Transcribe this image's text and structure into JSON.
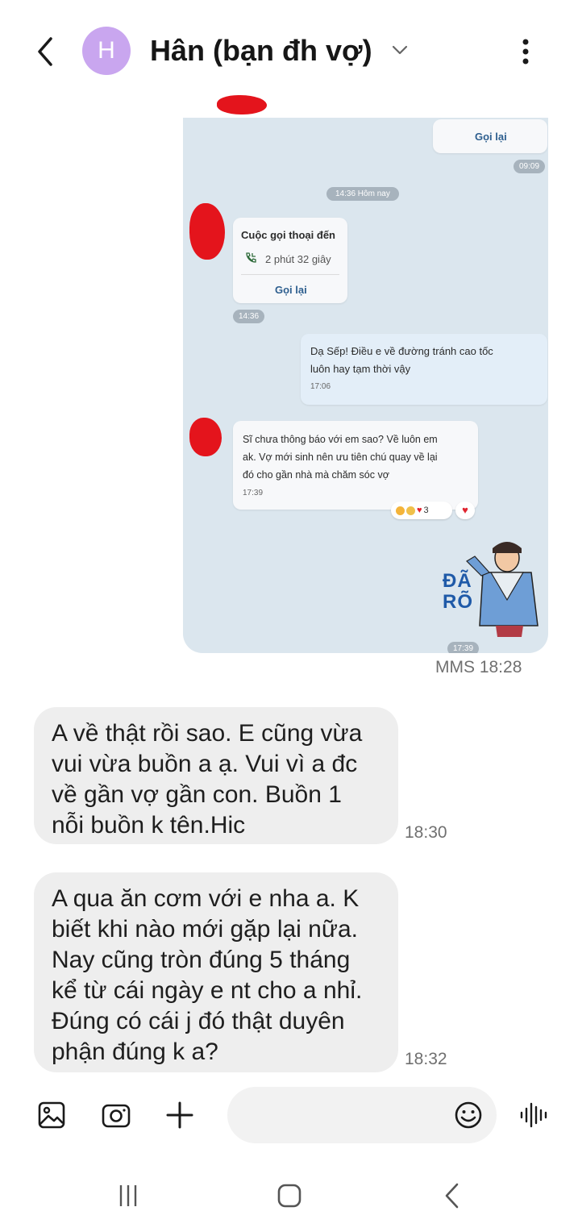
{
  "header": {
    "avatar_letter": "H",
    "contact_name": "Hân (bạn đh vợ)",
    "avatar_color": "#c9a6ef"
  },
  "screenshot": {
    "call_back_label_top": "Gọi lại",
    "time_top": "09:09",
    "date_divider": "14:36 Hôm nay",
    "incoming_call_title": "Cuộc gọi thoại đến",
    "call_duration": "2 phút 32 giây",
    "call_back_label": "Gọi lại",
    "call_time": "14:36",
    "sent_text_line1": "Dạ Sếp! Điều e về đường tránh cao tốc",
    "sent_text_line2": "luôn hay tạm thời vậy",
    "sent_time": "17:06",
    "reply_line1": "Sĩ chưa thông báo với em sao? Về luôn em",
    "reply_line2": "ak. Vợ mới sinh nên ưu tiên chú quay về lại",
    "reply_line3": "đó cho gần nhà mà chăm sóc vợ",
    "reply_time": "17:39",
    "reaction_count": "3",
    "sticker_text": "ĐÃ RÕ",
    "sticker_time": "17:39"
  },
  "mms_meta": "MMS 18:28",
  "messages": [
    {
      "text": "A về thật rồi sao. E cũng vừa vui vừa buồn a ạ. Vui vì a đc về gần vợ gần con. Buồn 1 nỗi buồn k tên.Hic",
      "time": "18:30"
    },
    {
      "text": "A qua ăn cơm với e nha a. K biết khi nào mới gặp lại nữa. Nay cũng tròn đúng 5 tháng kể từ cái ngày e nt cho a nhỉ. Đúng có cái j đó thật duyên phận đúng k a?",
      "time": "18:32"
    }
  ],
  "composer": {
    "placeholder": "",
    "icons": [
      "gallery-icon",
      "camera-icon",
      "plus-icon",
      "emoji-icon",
      "voice-wave-icon"
    ]
  },
  "navbar": {
    "icons": [
      "recents-icon",
      "home-icon",
      "back-nav-icon"
    ]
  }
}
